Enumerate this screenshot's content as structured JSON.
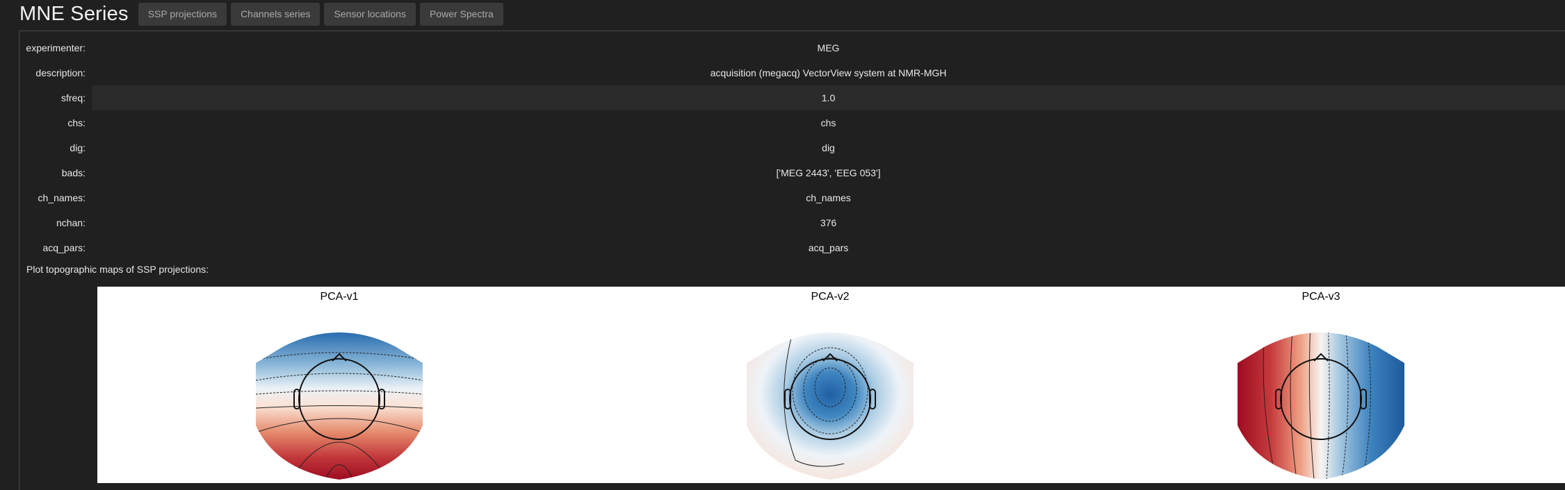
{
  "header": {
    "title": "MNE Series",
    "tabs": [
      "SSP projections",
      "Channels series",
      "Sensor locations",
      "Power Spectra"
    ]
  },
  "info_table": [
    {
      "key": "experimenter:",
      "value": "MEG"
    },
    {
      "key": "description:",
      "value": "acquisition (megacq) VectorView system at NMR-MGH"
    },
    {
      "key": "sfreq:",
      "value": "1.0"
    },
    {
      "key": "chs:",
      "value": "chs"
    },
    {
      "key": "dig:",
      "value": "dig"
    },
    {
      "key": "bads:",
      "value": "['MEG 2443', 'EEG 053']"
    },
    {
      "key": "ch_names:",
      "value": "ch_names"
    },
    {
      "key": "nchan:",
      "value": "376"
    },
    {
      "key": "acq_pars:",
      "value": "acq_pars"
    }
  ],
  "plot_caption": "Plot topographic maps of SSP projections:",
  "topomaps": [
    {
      "title": "PCA-v1"
    },
    {
      "title": "PCA-v2"
    },
    {
      "title": "PCA-v3"
    }
  ],
  "colors": {
    "background": "#202020",
    "tab": "#3a3a3a",
    "positive": "#b2182b",
    "negative": "#2166ac"
  }
}
